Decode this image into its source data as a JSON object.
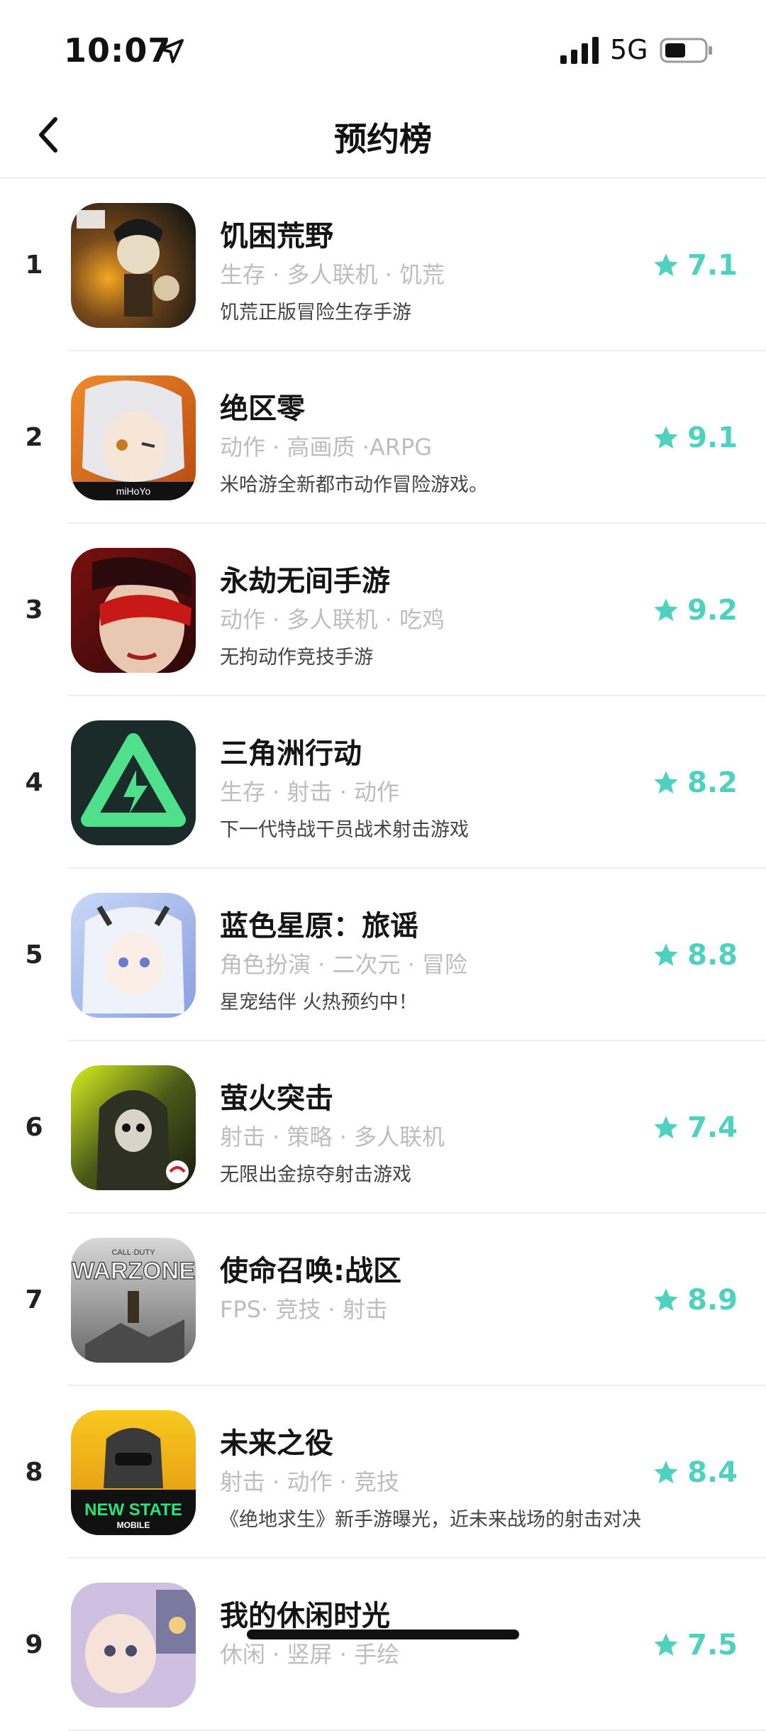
{
  "status_bar": {
    "time": "10:07",
    "network": "5G",
    "icons": [
      "location-arrow-icon",
      "cellular-signal-icon",
      "battery-icon"
    ]
  },
  "nav": {
    "title": "预约榜",
    "back_icon": "chevron-left-icon"
  },
  "colors": {
    "accent": "#4fd1c0",
    "tag_gray": "#bdbdbd",
    "divider": "#efefef"
  },
  "games": [
    {
      "rank": "1",
      "name": "饥困荒野",
      "tags": "生存 · 多人联机 · 饥荒",
      "desc": "饥荒正版冒险生存手游",
      "rating": "7.1",
      "icon": "dont-starve-app-icon"
    },
    {
      "rank": "2",
      "name": "绝区零",
      "tags": "动作 · 高画质 ·ARPG",
      "desc": "米哈游全新都市动作冒险游戏。",
      "rating": "9.1",
      "icon": "zenless-zone-zero-app-icon"
    },
    {
      "rank": "3",
      "name": "永劫无间手游",
      "tags": "动作 · 多人联机 · 吃鸡",
      "desc": "无拘动作竞技手游",
      "rating": "9.2",
      "icon": "naraka-app-icon"
    },
    {
      "rank": "4",
      "name": "三角洲行动",
      "tags": "生存 · 射击 · 动作",
      "desc": "下一代特战干员战术射击游戏",
      "rating": "8.2",
      "icon": "delta-force-app-icon"
    },
    {
      "rank": "5",
      "name": "蓝色星原：旅谣",
      "tags": "角色扮演 · 二次元 · 冒险",
      "desc": "星宠结伴 火热预约中！",
      "rating": "8.8",
      "icon": "blue-star-app-icon"
    },
    {
      "rank": "6",
      "name": "萤火突击",
      "tags": "射击 · 策略 · 多人联机",
      "desc": "无限出金掠夺射击游戏",
      "rating": "7.4",
      "icon": "firefly-assault-app-icon"
    },
    {
      "rank": "7",
      "name": "使命召唤:战区",
      "tags": "FPS· 竞技 · 射击",
      "desc": "",
      "rating": "8.9",
      "icon": "warzone-app-icon",
      "icon_text_small": "CALL·DUTY",
      "icon_text": "WARZONE"
    },
    {
      "rank": "8",
      "name": "未来之役",
      "tags": "射击 · 动作 · 竞技",
      "desc": "《绝地求生》新手游曝光，近未来战场的射击对决",
      "rating": "8.4",
      "icon": "new-state-app-icon",
      "icon_text": "NEW STATE",
      "icon_text_small": "MOBILE"
    },
    {
      "rank": "9",
      "name": "我的休闲时光",
      "tags": "休闲 · 竖屏 · 手绘",
      "desc": "",
      "rating": "7.5",
      "icon": "leisure-time-app-icon"
    }
  ]
}
